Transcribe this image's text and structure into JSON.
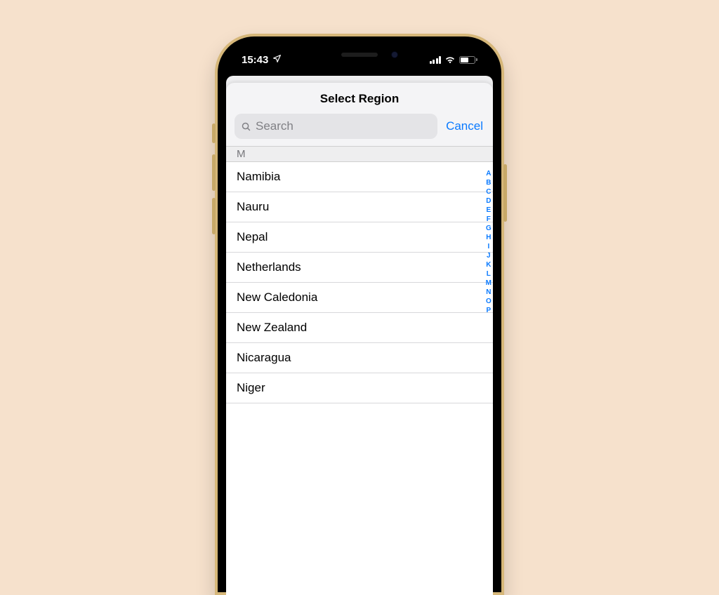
{
  "status_bar": {
    "time": "15:43"
  },
  "sheet": {
    "title": "Select Region",
    "search_placeholder": "Search",
    "cancel_label": "Cancel",
    "section_letter": "M",
    "items": [
      "Namibia",
      "Nauru",
      "Nepal",
      "Netherlands",
      "New Caledonia",
      "New Zealand",
      "Nicaragua",
      "Niger"
    ],
    "alpha_index": [
      "A",
      "B",
      "C",
      "D",
      "E",
      "F",
      "G",
      "H",
      "I",
      "J",
      "K",
      "L",
      "M",
      "N",
      "O",
      "P"
    ]
  }
}
